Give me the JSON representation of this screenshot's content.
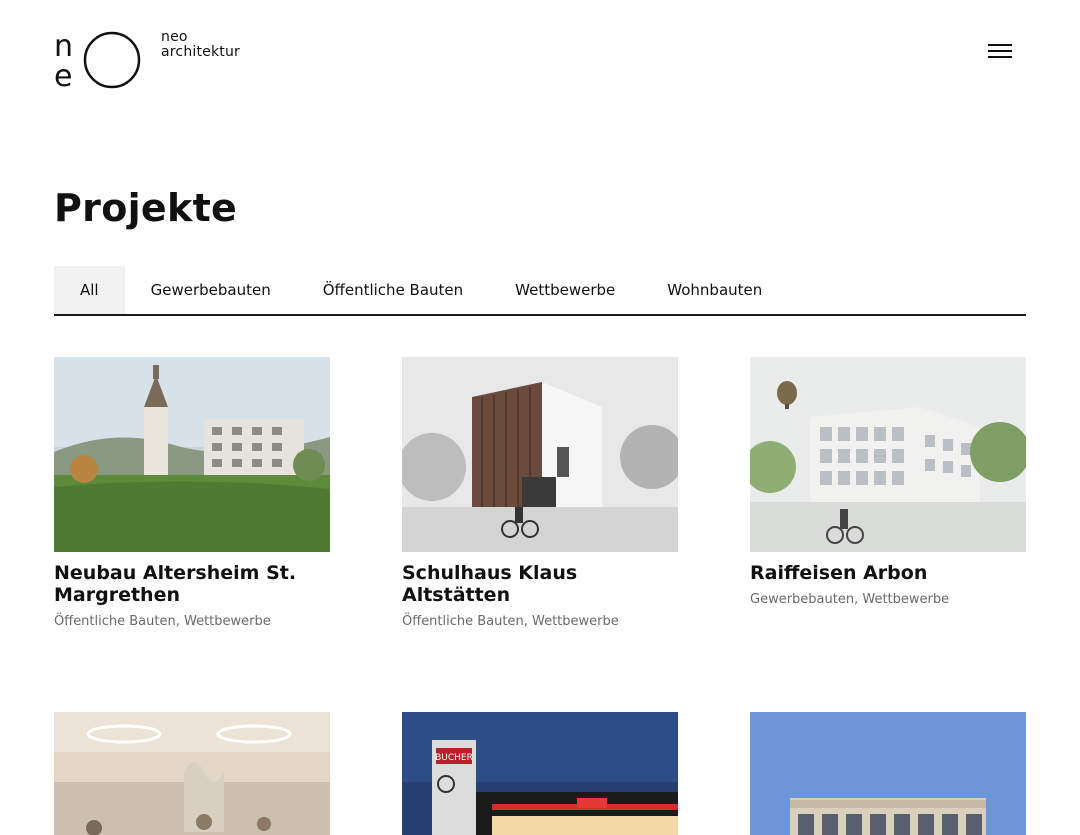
{
  "header": {
    "logo_line1": "neo",
    "logo_line2": "architektur",
    "logo_glyph_n": "n",
    "logo_glyph_e": "e"
  },
  "page": {
    "title": "Projekte"
  },
  "filters": [
    {
      "label": "All",
      "active": true
    },
    {
      "label": "Gewerbebauten",
      "active": false
    },
    {
      "label": "Öffentliche Bauten",
      "active": false
    },
    {
      "label": "Wettbewerbe",
      "active": false
    },
    {
      "label": "Wohnbauten",
      "active": false
    }
  ],
  "projects": [
    {
      "title": "Neubau Altersheim St. Margrethen",
      "categories": "Öffentliche Bauten, Wettbewerbe"
    },
    {
      "title": "Schulhaus Klaus Altstätten",
      "categories": "Öffentliche Bauten, Wettbewerbe"
    },
    {
      "title": "Raiffeisen Arbon",
      "categories": "Gewerbebauten, Wettbewerbe"
    },
    {
      "title": "",
      "categories": ""
    },
    {
      "title": "",
      "categories": ""
    },
    {
      "title": "",
      "categories": ""
    }
  ],
  "signage": {
    "store_name": "BUCHER"
  },
  "colors": {
    "accent": "#111111",
    "muted": "#6a6a6a",
    "tab_active_bg": "#f1f1f1"
  }
}
